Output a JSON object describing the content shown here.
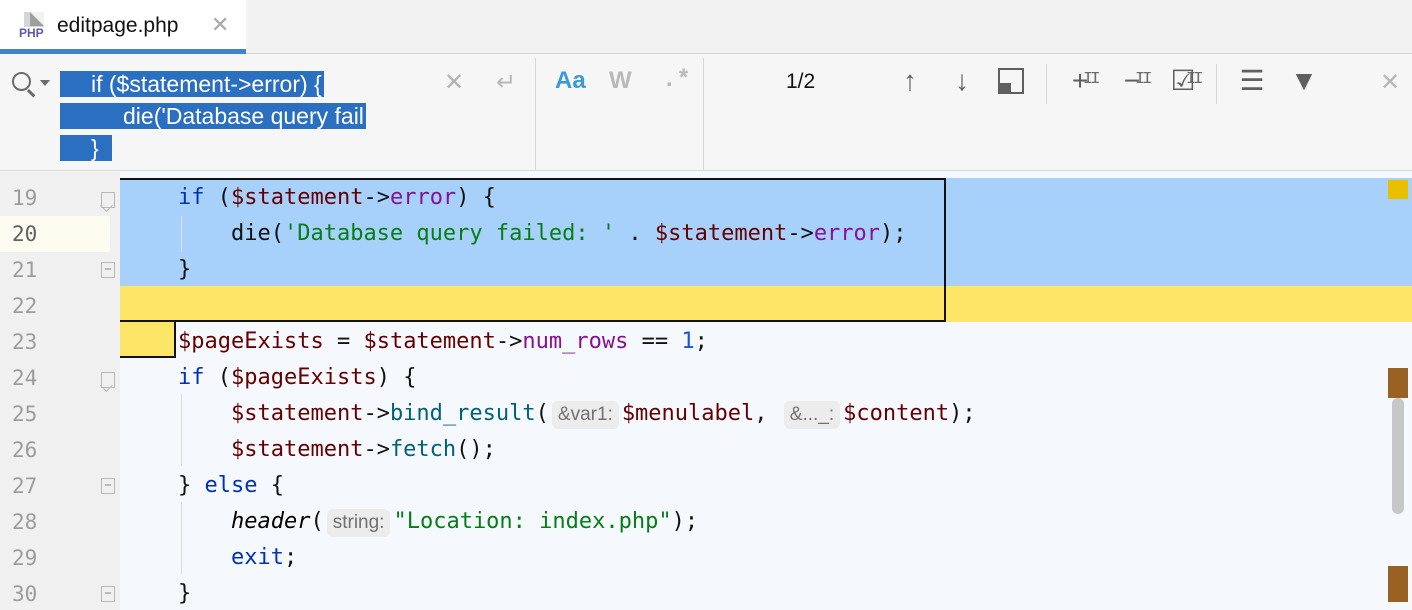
{
  "tab": {
    "title": "editpage.php",
    "icon": "php-file-icon",
    "icon_text": "PHP",
    "close": "✕"
  },
  "find": {
    "query_lines": [
      "if ($statement->error) {",
      "die('Database query fail",
      "}"
    ],
    "clear": "✕",
    "newline": "↵",
    "options": {
      "match_case": "Aa",
      "words": "W",
      "regex": ".*"
    },
    "match_count": "1/2",
    "close": "✕",
    "cursor_mark": "II"
  },
  "editor": {
    "line_numbers": [
      "19",
      "20",
      "21",
      "22",
      "23",
      "24",
      "25",
      "26",
      "27",
      "28",
      "29",
      "30"
    ],
    "current_line": "20",
    "hints": {
      "var1": "&var1:",
      "var2": "&..._:",
      "string": "string:"
    }
  },
  "colors": {
    "keyword": "#0033b3",
    "variable": "#660000",
    "string": "#067d17",
    "number": "#1750eb",
    "selection": "#a7d0fb",
    "match": "#fde567",
    "accent": "#4083c9"
  }
}
